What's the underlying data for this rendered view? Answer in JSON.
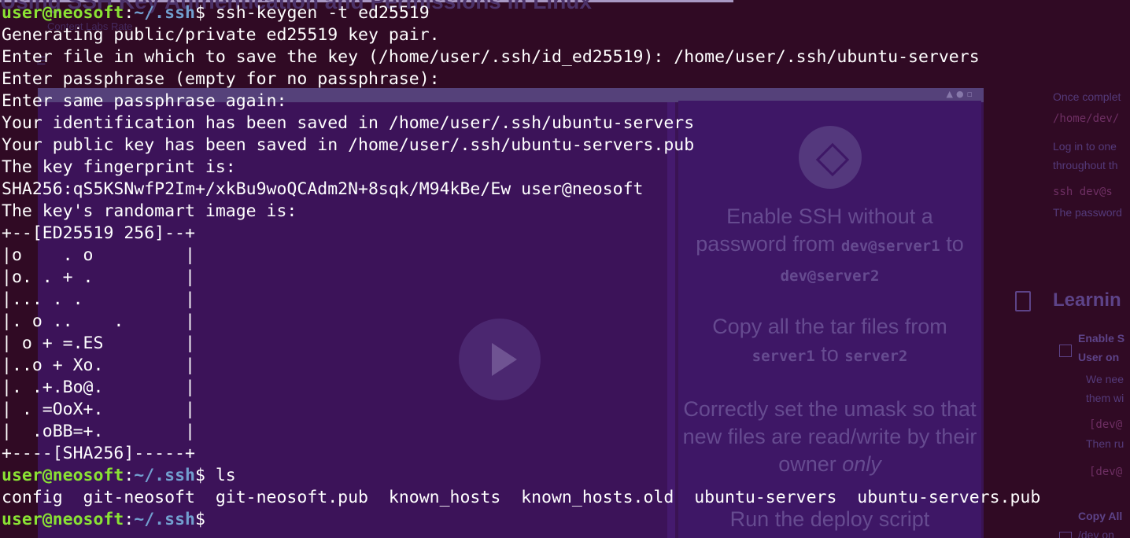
{
  "background_page": {
    "title": "Using SSH Key Authentication and Permissions in Linux",
    "breadcrumb": "Content   Labs   Rate",
    "panel_items": [
      {
        "text": "Enable SSH without a password from ",
        "code": "dev@server1",
        "text2": " to ",
        "code2": "dev@server2"
      },
      {
        "text": "Copy all the tar files from ",
        "code": "server1",
        "text2": " to ",
        "code2": "server2"
      },
      {
        "text": "Correctly set the umask so that new files are read/write by their owner ",
        "em": "only"
      },
      {
        "text": "Run the deploy script"
      }
    ],
    "side_lines": [
      "Once complet",
      "/home/dev/",
      "Log in to one",
      "throughout th",
      "ssh dev@s",
      "The password",
      "Learnin",
      "Enable S",
      "User on",
      "We nee",
      "them wi",
      "[dev@",
      "Then ru",
      "[dev@",
      "Copy All",
      "/dev  on"
    ]
  },
  "terminal": {
    "prompt": {
      "user_host": "user@neosoft",
      "sep": ":",
      "path": "~/.ssh",
      "symbol": "$"
    },
    "lines": [
      {
        "type": "cmd",
        "text": " ssh-keygen -t ed25519"
      },
      {
        "type": "out",
        "text": "Generating public/private ed25519 key pair."
      },
      {
        "type": "out",
        "text": "Enter file in which to save the key (/home/user/.ssh/id_ed25519): /home/user/.ssh/ubuntu-servers"
      },
      {
        "type": "out",
        "text": "Enter passphrase (empty for no passphrase):"
      },
      {
        "type": "out",
        "text": "Enter same passphrase again:"
      },
      {
        "type": "out",
        "text": "Your identification has been saved in /home/user/.ssh/ubuntu-servers"
      },
      {
        "type": "out",
        "text": "Your public key has been saved in /home/user/.ssh/ubuntu-servers.pub"
      },
      {
        "type": "out",
        "text": "The key fingerprint is:"
      },
      {
        "type": "out",
        "text": "SHA256:qS5KSNwfP2Im+/xkBu9woQCAdm2N+8sqk/M94kBe/Ew user@neosoft"
      },
      {
        "type": "out",
        "text": "The key's randomart image is:"
      },
      {
        "type": "out",
        "text": "+--[ED25519 256]--+"
      },
      {
        "type": "out",
        "text": "|o    . o         |"
      },
      {
        "type": "out",
        "text": "|o. . + .         |"
      },
      {
        "type": "out",
        "text": "|... . .          |"
      },
      {
        "type": "out",
        "text": "|. o ..    .      |"
      },
      {
        "type": "out",
        "text": "| o + =.ES        |"
      },
      {
        "type": "out",
        "text": "|..o + Xo.        |"
      },
      {
        "type": "out",
        "text": "|. .+.Bo@.        |"
      },
      {
        "type": "out",
        "text": "| . =OoX+.        |"
      },
      {
        "type": "out",
        "text": "|  .oBB=+.        |"
      },
      {
        "type": "out",
        "text": "+----[SHA256]-----+"
      },
      {
        "type": "cmd",
        "text": " ls"
      },
      {
        "type": "out",
        "text": "config  git-neosoft  git-neosoft.pub  known_hosts  known_hosts.old  ubuntu-servers  ubuntu-servers.pub"
      },
      {
        "type": "cmd",
        "text": ""
      }
    ]
  },
  "colors": {
    "terminal_bg": "#300a24",
    "prompt_user": "#8ae234",
    "prompt_path": "#729fcf",
    "text": "#ffffff"
  }
}
